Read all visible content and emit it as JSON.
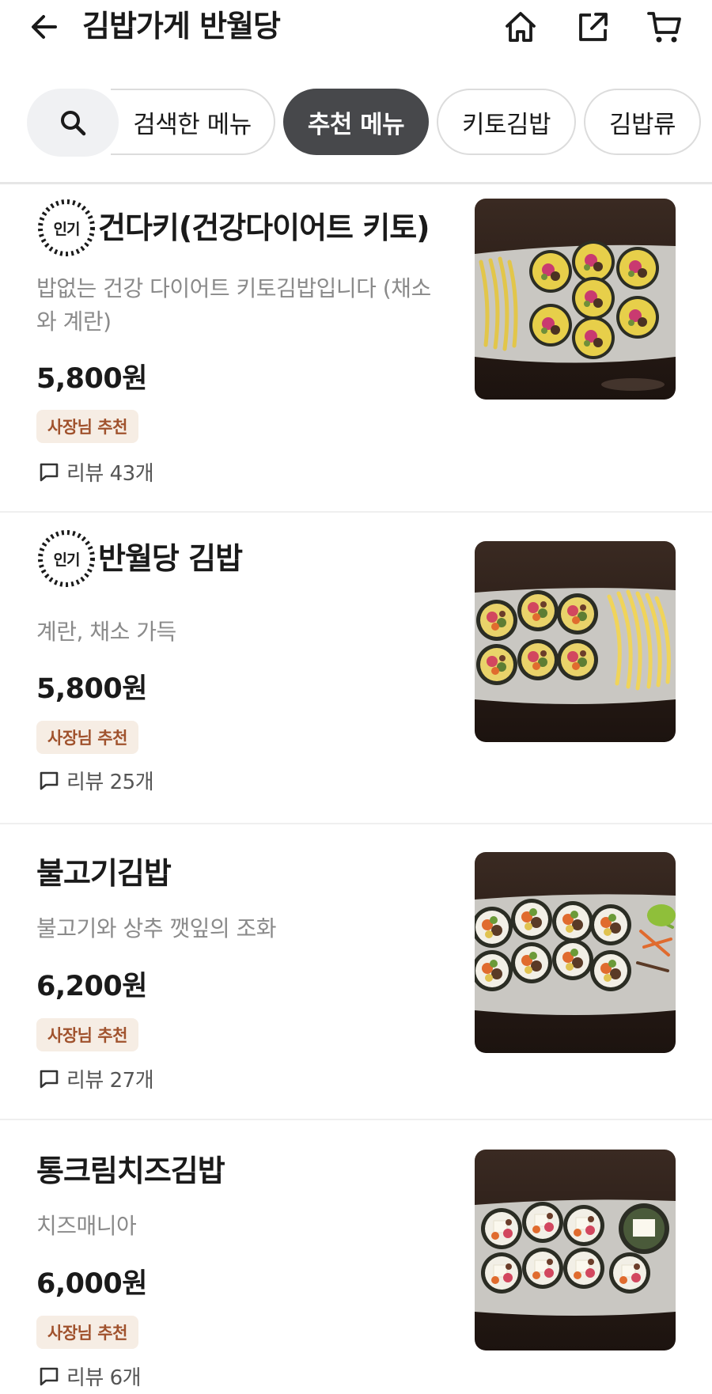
{
  "header": {
    "title": "김밥가게 반월당",
    "back_icon": "arrow-left-icon",
    "home_icon": "home-icon",
    "share_icon": "share-icon",
    "cart_icon": "cart-icon"
  },
  "tabs": [
    {
      "label": "검색한 메뉴",
      "active": false
    },
    {
      "label": "추천 메뉴",
      "active": true
    },
    {
      "label": "키토김밥",
      "active": false
    },
    {
      "label": "김밥류",
      "active": false
    }
  ],
  "popular_label": "인기",
  "menu_items": [
    {
      "name": "건다키(건강다이어트 키토)",
      "popular": true,
      "description": "밥없는 건강 다이어트 키토김밥입니다 (채소와 계란)",
      "price": "5,800원",
      "badge": "사장님 추천",
      "reviews": "리뷰 43개"
    },
    {
      "name": "반월당 김밥",
      "popular": true,
      "description": "계란, 채소 가득",
      "price": "5,800원",
      "badge": "사장님 추천",
      "reviews": "리뷰 25개"
    },
    {
      "name": "불고기김밥",
      "popular": false,
      "description": "불고기와 상추 깻잎의 조화",
      "price": "6,200원",
      "badge": "사장님 추천",
      "reviews": "리뷰 27개"
    },
    {
      "name": "통크림치즈김밥",
      "popular": false,
      "description": "치즈매니아",
      "price": "6,000원",
      "badge": "사장님 추천",
      "reviews": "리뷰 6개"
    }
  ],
  "colors": {
    "active_tab_bg": "#47484b",
    "owner_badge_bg": "#f6ede4",
    "owner_badge_text": "#a0522d"
  }
}
